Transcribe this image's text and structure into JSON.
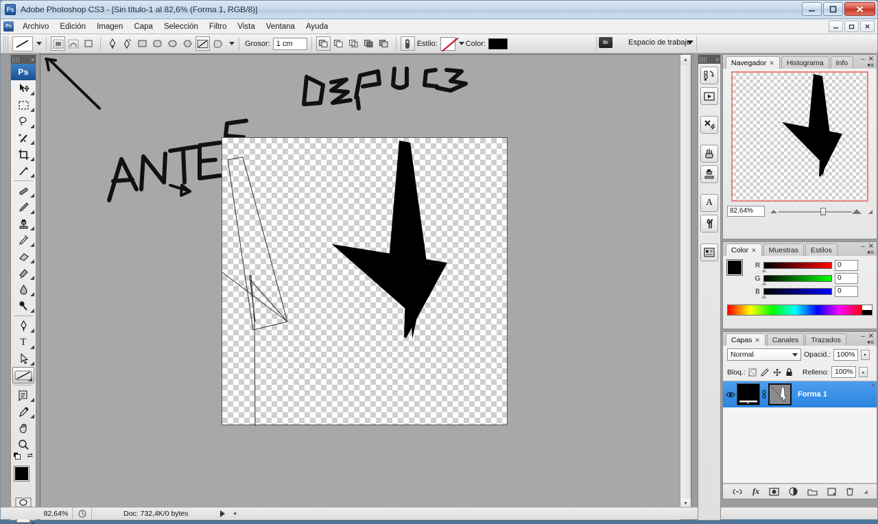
{
  "window": {
    "app_icon": "photoshop-icon",
    "title": "Adobe Photoshop CS3 - [Sin título-1 al 82,6% (Forma 1, RGB/8)]",
    "minimize": "–",
    "maximize": "❐",
    "close": "✕"
  },
  "menubar": {
    "items": [
      "Archivo",
      "Edición",
      "Imagen",
      "Capa",
      "Selección",
      "Filtro",
      "Vista",
      "Ventana",
      "Ayuda"
    ],
    "doc_minimize": "–",
    "doc_restore": "❐",
    "doc_close": "✕"
  },
  "options_bar": {
    "tool_preview_icon": "line-tool-icon",
    "preset_caret": "▾",
    "mode_buttons": [
      {
        "icon": "shape-layer-icon",
        "selected": true
      },
      {
        "icon": "paths-icon",
        "selected": false
      },
      {
        "icon": "fill-pixels-icon",
        "selected": false
      }
    ],
    "shape_tools": [
      {
        "icon": "pen-tool-icon",
        "selected": false
      },
      {
        "icon": "freeform-pen-icon",
        "selected": false
      },
      {
        "icon": "rectangle-icon",
        "selected": false
      },
      {
        "icon": "rounded-rectangle-icon",
        "selected": false
      },
      {
        "icon": "ellipse-icon",
        "selected": false
      },
      {
        "icon": "polygon-icon",
        "selected": false
      },
      {
        "icon": "line-icon",
        "selected": true
      },
      {
        "icon": "custom-shape-icon",
        "selected": false
      }
    ],
    "shape_caret": "▾",
    "weight_label": "Grosor:",
    "weight_value": "1 cm",
    "path_ops": [
      {
        "icon": "add-to-shape-icon"
      },
      {
        "icon": "subtract-from-shape-icon"
      },
      {
        "icon": "intersect-shape-icon"
      },
      {
        "icon": "exclude-shape-icon"
      },
      {
        "icon": "combine-shape-icon"
      }
    ],
    "layer_style_icon": "layer-style-icon",
    "style_label": "Estilo:",
    "style_value_icon": "no-style-icon",
    "style_caret": "▾",
    "color_label": "Color:",
    "color_value": "#000000",
    "bridge_icon": "bridge-icon",
    "workspace_label": "Espacio de trabajo",
    "workspace_caret": "▼"
  },
  "toolbox": {
    "collapse_icon": "double-arrow-icon",
    "logo": "Ps",
    "tools": [
      {
        "name": "move-tool",
        "glyph": "✛",
        "has_submenu": true,
        "selected": false
      },
      {
        "name": "rectangular-marquee-tool",
        "glyph": "▭",
        "has_submenu": true,
        "selected": false
      },
      {
        "name": "lasso-tool",
        "glyph": "◠",
        "has_submenu": true,
        "selected": false
      },
      {
        "name": "magic-wand-tool",
        "glyph": "✦",
        "has_submenu": true,
        "selected": false
      },
      {
        "name": "crop-tool",
        "glyph": "⌗",
        "has_submenu": true,
        "selected": false
      },
      {
        "name": "slice-tool",
        "glyph": "✂",
        "has_submenu": true,
        "selected": false
      },
      {
        "name": "healing-brush-tool",
        "glyph": "✎",
        "has_submenu": true,
        "selected": false
      },
      {
        "name": "brush-tool",
        "glyph": "🖌",
        "has_submenu": true,
        "selected": false
      },
      {
        "name": "clone-stamp-tool",
        "glyph": "❆",
        "has_submenu": true,
        "selected": false
      },
      {
        "name": "history-brush-tool",
        "glyph": "❧",
        "has_submenu": true,
        "selected": false
      },
      {
        "name": "eraser-tool",
        "glyph": "◻",
        "has_submenu": true,
        "selected": false
      },
      {
        "name": "gradient-tool",
        "glyph": "▤",
        "has_submenu": true,
        "selected": false
      },
      {
        "name": "blur-tool",
        "glyph": "◍",
        "has_submenu": true,
        "selected": false
      },
      {
        "name": "dodge-tool",
        "glyph": "◑",
        "has_submenu": true,
        "selected": false
      },
      {
        "name": "pen-tool",
        "glyph": "✒",
        "has_submenu": true,
        "selected": false
      },
      {
        "name": "type-tool",
        "glyph": "T",
        "has_submenu": true,
        "selected": false
      },
      {
        "name": "path-selection-tool",
        "glyph": "↖",
        "has_submenu": true,
        "selected": false
      },
      {
        "name": "line-shape-tool",
        "glyph": "╲",
        "has_submenu": true,
        "selected": true
      },
      {
        "name": "notes-tool",
        "glyph": "▤",
        "has_submenu": true,
        "selected": false
      },
      {
        "name": "eyedropper-tool",
        "glyph": "⌁",
        "has_submenu": true,
        "selected": false
      },
      {
        "name": "hand-tool",
        "glyph": "✋",
        "has_submenu": false,
        "selected": false
      },
      {
        "name": "zoom-tool",
        "glyph": "🔍",
        "has_submenu": false,
        "selected": false
      }
    ],
    "foreground_color": "#000000",
    "background_color": "#000000",
    "swap_icon": "swap-colors-icon",
    "default_icon": "default-colors-icon",
    "quick_mask_icon": "quick-mask-icon",
    "screen_mode_icon": "screen-mode-icon"
  },
  "canvas": {
    "annotations": [
      {
        "name": "antes-label",
        "text": "ANTES"
      },
      {
        "name": "despues-label",
        "text": "DESPUES"
      }
    ],
    "shape_layer_fill": "#000000",
    "path_outline_color": "#2b2b2b"
  },
  "document_status": {
    "zoom": "82,64%",
    "doc_info_icon": "doc-size-icon",
    "doc_info": "Doc: 732,4K/0 bytes",
    "play_icon": "▶",
    "left_arrow": "◂"
  },
  "dock_strip": {
    "collapse_icon": "«",
    "buttons": [
      {
        "name": "brushes-preset-icon",
        "glyph": "▦"
      },
      {
        "name": "animation-icon",
        "glyph": "▶"
      },
      {
        "name": "tool-presets-icon",
        "glyph": "✂"
      },
      {
        "name": "brushes-icon",
        "glyph": "❦"
      },
      {
        "name": "clone-source-icon",
        "glyph": "❁"
      },
      {
        "name": "character-icon",
        "glyph": "A"
      },
      {
        "name": "paragraph-icon",
        "glyph": "¶"
      },
      {
        "name": "layer-comps-icon",
        "glyph": "▤"
      }
    ]
  },
  "navigator_panel": {
    "tabs": [
      {
        "label": "Navegador",
        "active": true,
        "closable": true
      },
      {
        "label": "Histograma",
        "active": false,
        "closable": false
      },
      {
        "label": "Info",
        "active": false,
        "closable": false
      }
    ],
    "minimize": "–",
    "close": "✕",
    "menu_icon": "panel-menu-icon",
    "zoom_value": "82.64%",
    "zoom_out_icon": "zoom-out-icon",
    "zoom_in_icon": "zoom-in-icon",
    "view_box_color": "#e8837f",
    "resize_grip_icon": "resize-grip-icon"
  },
  "color_panel": {
    "tabs": [
      {
        "label": "Color",
        "active": true,
        "closable": true
      },
      {
        "label": "Muestras",
        "active": false,
        "closable": false
      },
      {
        "label": "Estilos",
        "active": false,
        "closable": false
      }
    ],
    "minimize": "–",
    "close": "✕",
    "menu_icon": "panel-menu-icon",
    "foreground_color": "#000000",
    "background_color": "#000000",
    "channels": [
      {
        "label": "R",
        "value": "0"
      },
      {
        "label": "G",
        "value": "0"
      },
      {
        "label": "B",
        "value": "0"
      }
    ]
  },
  "layers_panel": {
    "tabs": [
      {
        "label": "Capas",
        "active": true,
        "closable": true
      },
      {
        "label": "Canales",
        "active": false,
        "closable": false
      },
      {
        "label": "Trazados",
        "active": false,
        "closable": false
      }
    ],
    "minimize": "–",
    "close": "✕",
    "menu_icon": "panel-menu-icon",
    "blend_mode": "Normal",
    "blend_caret": "▾",
    "opacity_label": "Opacid.:",
    "opacity_value": "100%",
    "opacity_caret": "▸",
    "lock_label": "Bloq.:",
    "lock_icons": [
      {
        "name": "lock-transparency-icon",
        "glyph": "▨"
      },
      {
        "name": "lock-image-icon",
        "glyph": "✎"
      },
      {
        "name": "lock-position-icon",
        "glyph": "✛"
      },
      {
        "name": "lock-all-icon",
        "glyph": "🔒"
      }
    ],
    "fill_label": "Relleno:",
    "fill_value": "100%",
    "fill_caret": "▸",
    "layers": [
      {
        "name": "Forma 1",
        "visible": true,
        "visibility_icon": "eye-icon",
        "link_icon": "link-icon",
        "selected": true
      }
    ],
    "footer_buttons": [
      {
        "name": "link-layers-button",
        "glyph": "⛓"
      },
      {
        "name": "layer-style-button",
        "glyph": "fx"
      },
      {
        "name": "layer-mask-button",
        "glyph": "◻"
      },
      {
        "name": "adjustment-layer-button",
        "glyph": "◑"
      },
      {
        "name": "new-group-button",
        "glyph": "🗀"
      },
      {
        "name": "new-layer-button",
        "glyph": "▣"
      },
      {
        "name": "delete-layer-button",
        "glyph": "🗑"
      }
    ]
  }
}
